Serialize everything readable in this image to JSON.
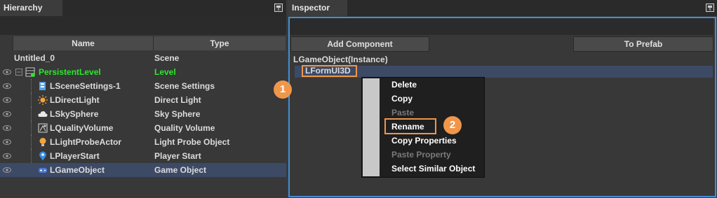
{
  "hierarchy": {
    "tab_label": "Hierarchy",
    "columns": {
      "name": "Name",
      "type": "Type"
    },
    "rows": [
      {
        "name": "Untitled_0",
        "type": "Scene"
      },
      {
        "name": "PersistentLevel",
        "type": "Level"
      },
      {
        "name": "LSceneSettings-1",
        "type": "Scene Settings"
      },
      {
        "name": "LDirectLight",
        "type": "Direct Light"
      },
      {
        "name": "LSkySphere",
        "type": "Sky Sphere"
      },
      {
        "name": "LQualityVolume",
        "type": "Quality Volume"
      },
      {
        "name": "LLightProbeActor",
        "type": "Light Probe Object"
      },
      {
        "name": "LPlayerStart",
        "type": "Player Start"
      },
      {
        "name": "LGameObject",
        "type": "Game Object"
      }
    ]
  },
  "inspector": {
    "tab_label": "Inspector",
    "add_component_label": "Add Component",
    "to_prefab_label": "To Prefab",
    "instance_label": "LGameObject(Instance)",
    "component_label": "LFormUI3D"
  },
  "context_menu": {
    "items": [
      {
        "label": "Delete",
        "disabled": false
      },
      {
        "label": "Copy",
        "disabled": false
      },
      {
        "label": "Paste",
        "disabled": true
      },
      {
        "label": "Rename",
        "disabled": false
      },
      {
        "label": "Copy Properties",
        "disabled": false
      },
      {
        "label": "Paste Property",
        "disabled": true
      },
      {
        "label": "Select Similar Object",
        "disabled": false
      }
    ]
  },
  "callouts": {
    "step1": "1",
    "step2": "2"
  },
  "colors": {
    "level_green": "#2ee62e",
    "highlight_orange": "#f0964a",
    "selection_blue": "#3d4a66"
  }
}
